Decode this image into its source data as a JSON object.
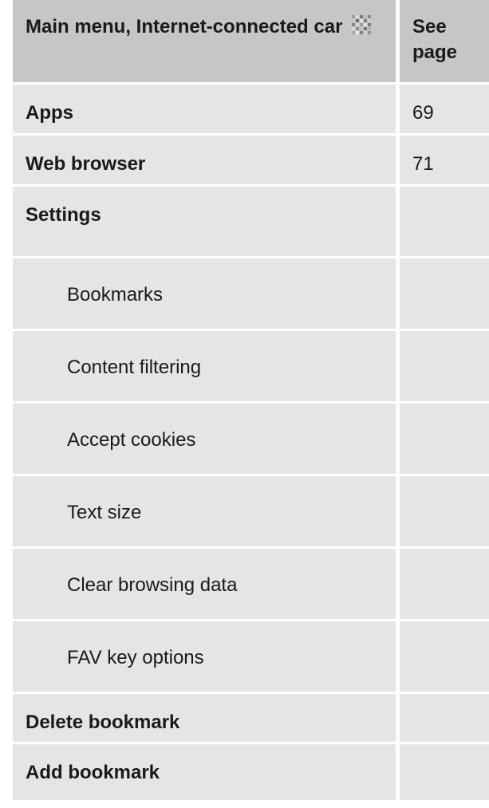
{
  "header": {
    "menu_title": "Main menu, Internet-connected car",
    "page_col_title": "See page"
  },
  "rows": [
    {
      "label": "Apps",
      "page": "69"
    },
    {
      "label": "Web browser",
      "page": "71"
    },
    {
      "label": "Settings",
      "page": ""
    },
    {
      "label": "Bookmarks",
      "page": ""
    },
    {
      "label": "Content filtering",
      "page": ""
    },
    {
      "label": "Accept cookies",
      "page": ""
    },
    {
      "label": "Text size",
      "page": ""
    },
    {
      "label": "Clear browsing data",
      "page": ""
    },
    {
      "label": "FAV key options",
      "page": ""
    },
    {
      "label": "Delete bookmark",
      "page": ""
    },
    {
      "label": "Add bookmark",
      "page": ""
    }
  ],
  "colors": {
    "header_bg": "#c6c6c8",
    "row_bg": "#e5e5e6",
    "disabled_text": "#8c8c8c",
    "text": "#1a1a1a"
  },
  "icons": {
    "header_icon": "internet-connected-car-icon"
  }
}
